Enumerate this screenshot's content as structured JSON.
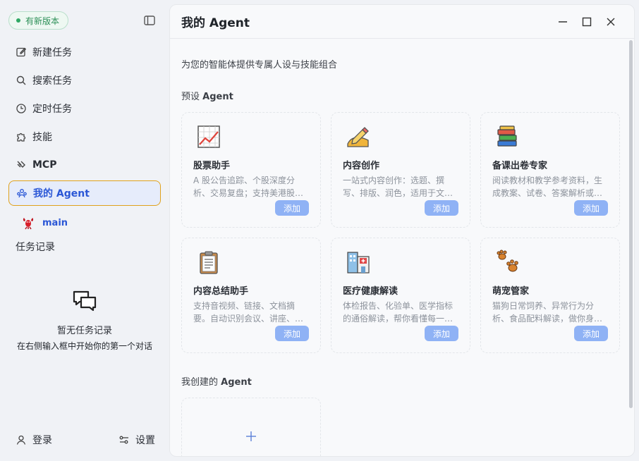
{
  "sidebar": {
    "new_version": "有新版本",
    "nav": [
      {
        "label": "新建任务",
        "icon": "edit-icon"
      },
      {
        "label": "搜索任务",
        "icon": "search-icon"
      },
      {
        "label": "定时任务",
        "icon": "clock-icon"
      },
      {
        "label": "技能",
        "icon": "puzzle-icon"
      },
      {
        "label": "MCP",
        "icon": "mcp-icon"
      },
      {
        "label": "我的 Agent",
        "icon": "agent-icon",
        "active": true
      }
    ],
    "agent_sub": "main",
    "task_record": "任务记录",
    "empty_title": "暂无任务记录",
    "empty_desc": "在右侧输入框中开始你的第一个对话",
    "login": "登录",
    "settings": "设置"
  },
  "main": {
    "title": "我的 Agent",
    "subtitle": "为您的智能体提供专属人设与技能组合",
    "preset_prefix": "预设 ",
    "preset_bold": "Agent",
    "mine_prefix": "我创建的 ",
    "mine_bold": "Agent",
    "add_label": "添加",
    "cards": [
      {
        "name": "股票助手",
        "desc": "A 股公告追踪、个股深度分析、交易复盘；支持美港股…",
        "icon": "chart-icon"
      },
      {
        "name": "内容创作",
        "desc": "一站式内容创作：选题、撰写、排版、润色，适用于文…",
        "icon": "pen-icon"
      },
      {
        "name": "备课出卷专家",
        "desc": "阅读教材和教学参考资料，生成教案、试卷、答案解析或…",
        "icon": "books-icon"
      },
      {
        "name": "内容总结助手",
        "desc": "支持音视频、链接、文档摘要。自动识别会议、讲座、…",
        "icon": "clipboard-icon"
      },
      {
        "name": "医疗健康解读",
        "desc": "体检报告、化验单、医学指标的通俗解读，帮你看懂每一…",
        "icon": "hospital-icon"
      },
      {
        "name": "萌宠管家",
        "desc": "猫狗日常饲养、异常行为分析、食品配料解读，做你身…",
        "icon": "paw-icon"
      }
    ]
  },
  "colors": {
    "accent": "#2b57d6",
    "active_border": "#e0a21c",
    "add_button": "#8fb2f5",
    "version_green": "#2c8f57"
  }
}
